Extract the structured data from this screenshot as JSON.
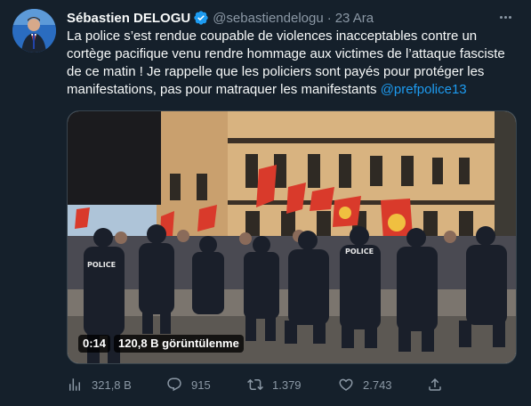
{
  "tweet": {
    "author_name": "Sébastien DELOGU",
    "handle": "@sebastiendelogu",
    "separator": "·",
    "date": "23 Ara",
    "text_main": "La police s’est rendue coupable de violences inacceptables contre un cortège pacifique venu rendre hommage aux victimes de l’attaque fasciste de ce matin ! Je rappelle que les policiers sont payés pour protéger les manifestations, pas pour matraquer les manifestants ",
    "mention": "@prefpolice13"
  },
  "media": {
    "duration": "0:14",
    "views_label": "120,8 B görüntülenme",
    "police_label": "POLICE"
  },
  "actions": {
    "views": "321,8 B",
    "replies": "915",
    "retweets": "1.379",
    "likes": "2.743"
  },
  "colors": {
    "background": "#15202b",
    "text": "#f7f9f9",
    "muted": "#8b98a5",
    "accent": "#1d9bf0"
  },
  "icons": [
    "verified-badge-icon",
    "more-icon",
    "views-icon",
    "reply-icon",
    "retweet-icon",
    "like-icon",
    "share-icon"
  ]
}
